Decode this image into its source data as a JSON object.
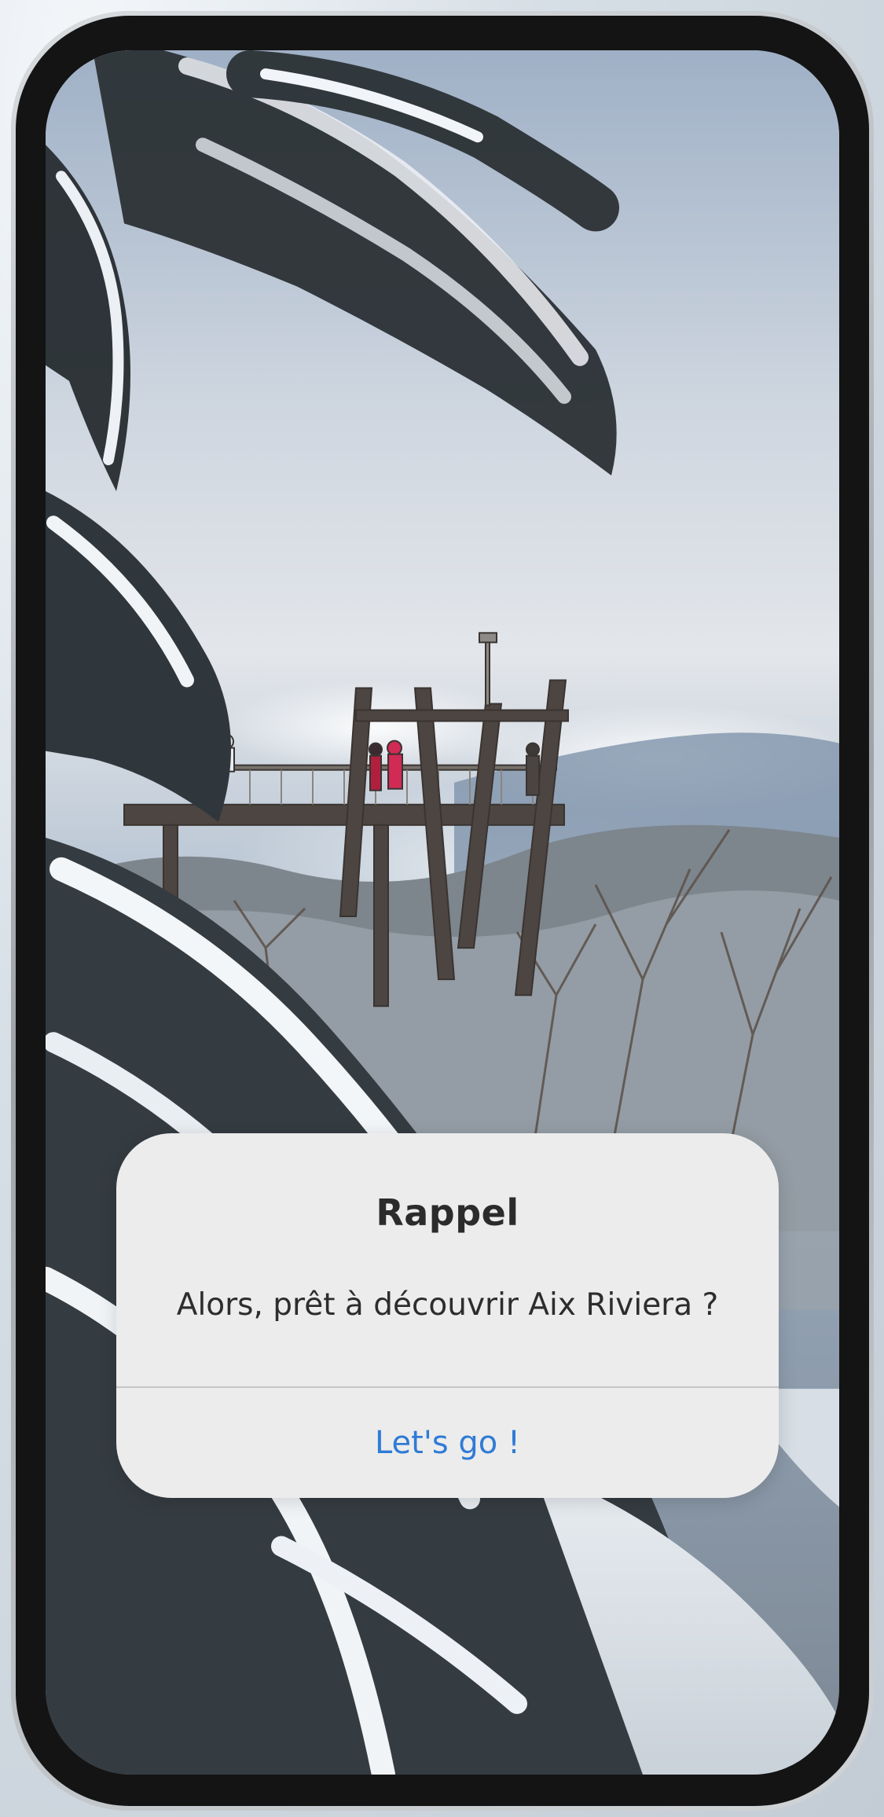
{
  "alert": {
    "title": "Rappel",
    "message": "Alors, prêt à découvrir Aix Riviera ?",
    "action_label": "Let's go !"
  },
  "colors": {
    "dialog_background": "#ececec",
    "action_text": "#2f7bd6",
    "title_text": "#2b2b2b",
    "bezel": "#141414"
  },
  "background": {
    "description_icon": "snowy-forest-viewpoint-wallpaper"
  }
}
